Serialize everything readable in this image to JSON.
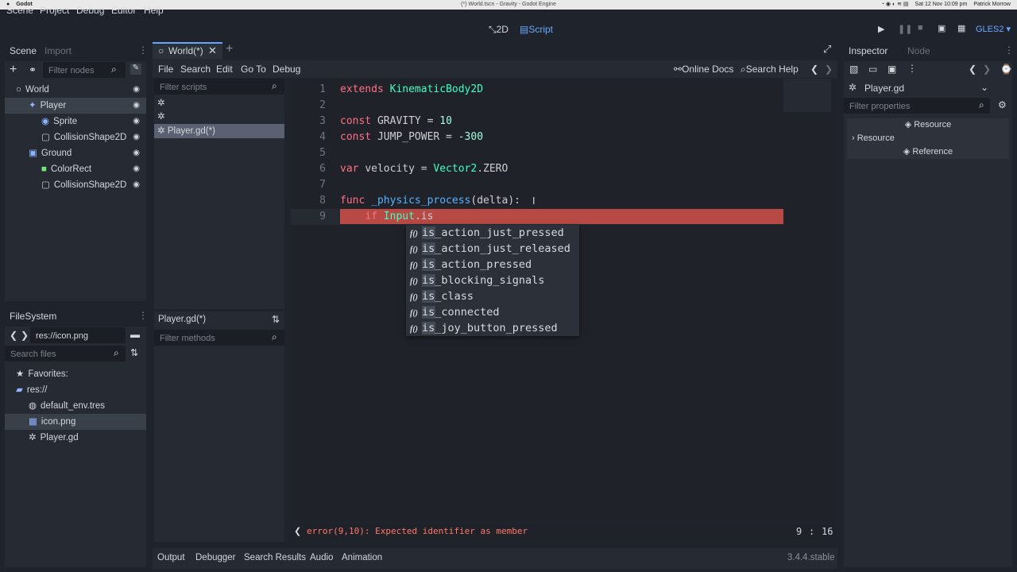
{
  "macbar": {
    "app": "Godot",
    "title": "(*) World.tscn - Gravity - Godot Engine",
    "datetime": "Sat 12 Nov  10:09 pm",
    "user": "Patrick Morrow"
  },
  "menu": [
    "Scene",
    "Project",
    "Debug",
    "Editor",
    "Help"
  ],
  "modes": {
    "two_d": "2D",
    "script": "Script"
  },
  "renderer": "GLES2",
  "scene_dock": {
    "tabs": [
      "Scene",
      "Import"
    ],
    "filter_placeholder": "Filter nodes",
    "nodes": [
      {
        "label": "World",
        "indent": 0,
        "icon": "node2d-icon"
      },
      {
        "label": "Player",
        "indent": 1,
        "icon": "kinematic-icon",
        "selected": true
      },
      {
        "label": "Sprite",
        "indent": 2,
        "icon": "sprite-icon"
      },
      {
        "label": "CollisionShape2D",
        "indent": 2,
        "icon": "collision-icon"
      },
      {
        "label": "Ground",
        "indent": 1,
        "icon": "staticbody-icon"
      },
      {
        "label": "ColorRect",
        "indent": 2,
        "icon": "colorrect-icon"
      },
      {
        "label": "CollisionShape2D",
        "indent": 2,
        "icon": "collision-icon"
      }
    ]
  },
  "filesystem": {
    "title": "FileSystem",
    "path": "res://icon.png",
    "search_placeholder": "Search files",
    "items": [
      {
        "label": "Favorites:",
        "indent": 0,
        "icon": "star-icon"
      },
      {
        "label": "res://",
        "indent": 0,
        "icon": "folder-icon"
      },
      {
        "label": "default_env.tres",
        "indent": 1,
        "icon": "globe-icon"
      },
      {
        "label": "icon.png",
        "indent": 1,
        "icon": "image-icon",
        "selected": true
      },
      {
        "label": "Player.gd",
        "indent": 1,
        "icon": "gear-icon"
      }
    ]
  },
  "center_tab": "World(*)",
  "script_menu": [
    "File",
    "Search",
    "Edit",
    "Go To",
    "Debug"
  ],
  "script_links": {
    "docs": "Online Docs",
    "help": "Search Help"
  },
  "scripts": {
    "filter_placeholder": "Filter scripts",
    "items": [
      "",
      "",
      "Player.gd(*)"
    ],
    "methods_title": "Player.gd(*)",
    "methods_placeholder": "Filter methods"
  },
  "code": [
    {
      "n": "1",
      "parts": [
        [
          "kw",
          "extends "
        ],
        [
          "ty",
          "KinematicBody2D"
        ]
      ]
    },
    {
      "n": "2",
      "parts": []
    },
    {
      "n": "3",
      "parts": [
        [
          "kw",
          "const "
        ],
        [
          "df",
          "GRAVITY = "
        ],
        [
          "nm",
          "10"
        ]
      ]
    },
    {
      "n": "4",
      "parts": [
        [
          "kw",
          "const "
        ],
        [
          "df",
          "JUMP_POWER = "
        ],
        [
          "nm",
          "-300"
        ]
      ]
    },
    {
      "n": "5",
      "parts": []
    },
    {
      "n": "6",
      "parts": [
        [
          "kw",
          "var "
        ],
        [
          "df",
          "velocity = "
        ],
        [
          "ty",
          "Vector2"
        ],
        [
          "df",
          ".ZERO"
        ]
      ]
    },
    {
      "n": "7",
      "parts": []
    },
    {
      "n": "8",
      "parts": [
        [
          "kw",
          "func "
        ],
        [
          "fn",
          "_physics_process"
        ],
        [
          "df",
          "(delta):"
        ]
      ]
    },
    {
      "n": "9",
      "parts": [
        [
          "df",
          "    "
        ],
        [
          "kw",
          "if "
        ],
        [
          "ty",
          "Input"
        ],
        [
          "df",
          ".is"
        ]
      ]
    }
  ],
  "autocomplete": {
    "prefix": "is",
    "icon_text": "f()",
    "items": [
      "is_action_just_pressed",
      "is_action_just_released",
      "is_action_pressed",
      "is_blocking_signals",
      "is_class",
      "is_connected",
      "is_joy_button_pressed"
    ]
  },
  "status": {
    "error": "error(9,10): Expected identifier as member",
    "line": "9",
    "sep": ":",
    "col": "16"
  },
  "bottom_tabs": [
    "Output",
    "Debugger",
    "Search Results",
    "Audio",
    "Animation"
  ],
  "version": "3.4.4.stable",
  "inspector": {
    "tabs": [
      "Inspector",
      "Node"
    ],
    "object": "Player.gd",
    "filter_placeholder": "Filter properties",
    "sections": [
      {
        "label": "Resource",
        "type": "header"
      },
      {
        "label": "Resource",
        "type": "sub"
      },
      {
        "label": "Reference",
        "type": "header"
      }
    ]
  },
  "colors": {
    "accent": "#6aa8ff",
    "error_line": "#d9554e",
    "keyword": "#ff7085",
    "type": "#42ffc2",
    "error_text": "#ff786b"
  }
}
